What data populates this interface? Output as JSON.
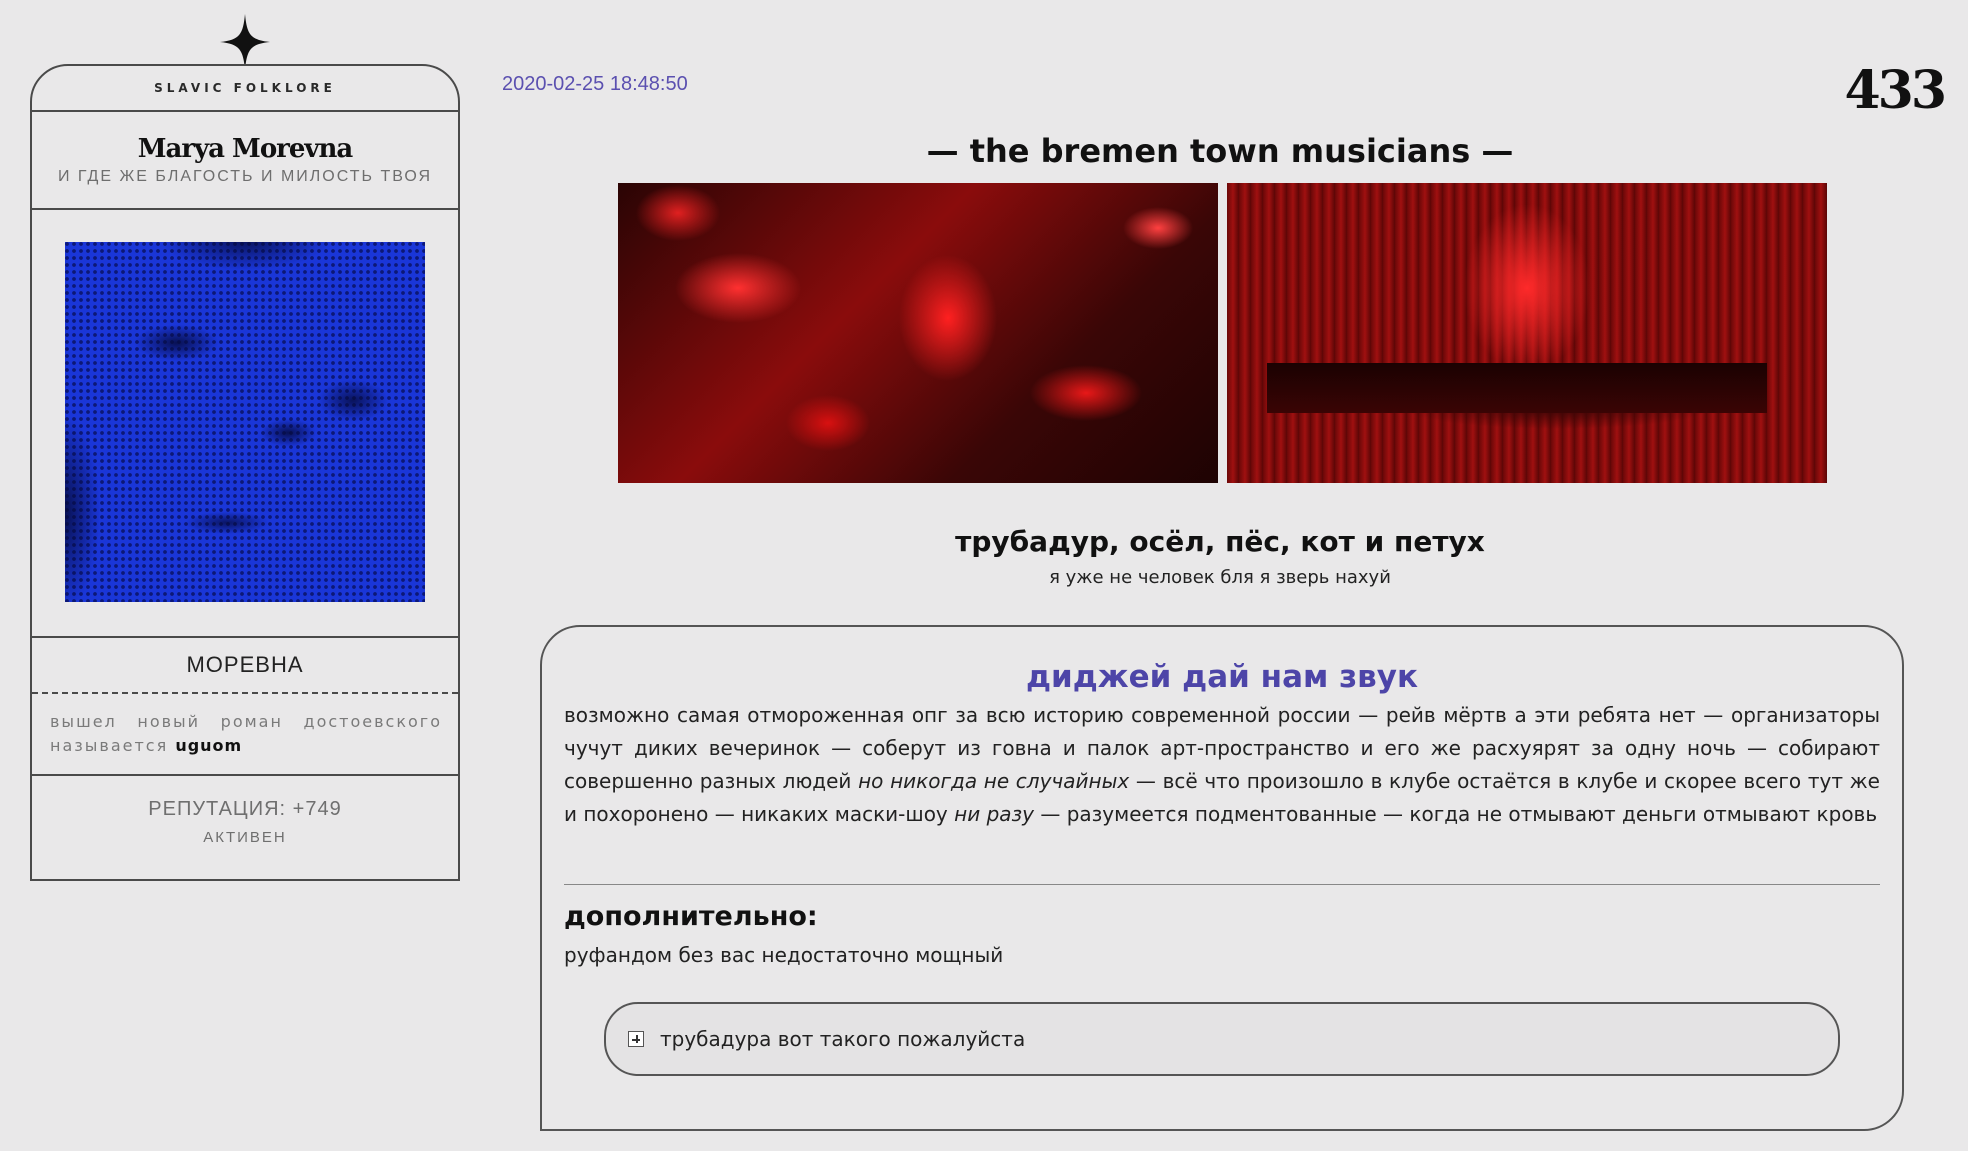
{
  "profile": {
    "group": "SLAVIC FOLKLORE",
    "name": "Marya Morevna",
    "subtitle": "И ГДЕ ЖЕ БЛАГОСТЬ И МИЛОСТЬ ТВОЯ",
    "nickname": "МОРЕВНА",
    "status_text": "вышел новый роман достоевского называется ",
    "status_highlight": "uguom",
    "reputation": "РЕПУТАЦИЯ: +749",
    "activity": "АКТИВЕН"
  },
  "post": {
    "timestamp": "2020-02-25 18:48:50",
    "number": "433",
    "title": "— the bremen town musicians —",
    "song_title": "трубадур, осёл, пёс, кот и петух",
    "tagline": "я уже не человек бля я зверь нахуй",
    "box_title": "диджей дай нам звук",
    "body_1": "возможно самая отмороженная опг за всю историю современной россии — рейв мёртв а эти ребята нет — организаторы чучут диких вечеринок — соберут из говна и палок арт-пространство и его же расхуярят за одну ночь — собирают совершенно разных людей ",
    "body_italic_1": "но никогда не случайных",
    "body_2": " — всё что произошло в клубе остаётся в клубе и скорее всего тут же и похоронено — никаких маски-шоу ",
    "body_italic_2": "ни разу",
    "body_3": " — разумеется подментованные — когда не отмывают деньги отмывают кровь",
    "extra_heading": "дополнительно:",
    "extra_text": "руфандом без вас недостаточно мощный",
    "spoiler_label": "трубадура вот такого пожалуйста"
  },
  "icons": {
    "star": "four-point-star-icon",
    "spoiler": "plus-box-icon"
  },
  "colors": {
    "accent": "#5b50b0",
    "background": "#e9e8e9",
    "avatar_blue": "#1a36d8",
    "image_red": "#e81818"
  }
}
